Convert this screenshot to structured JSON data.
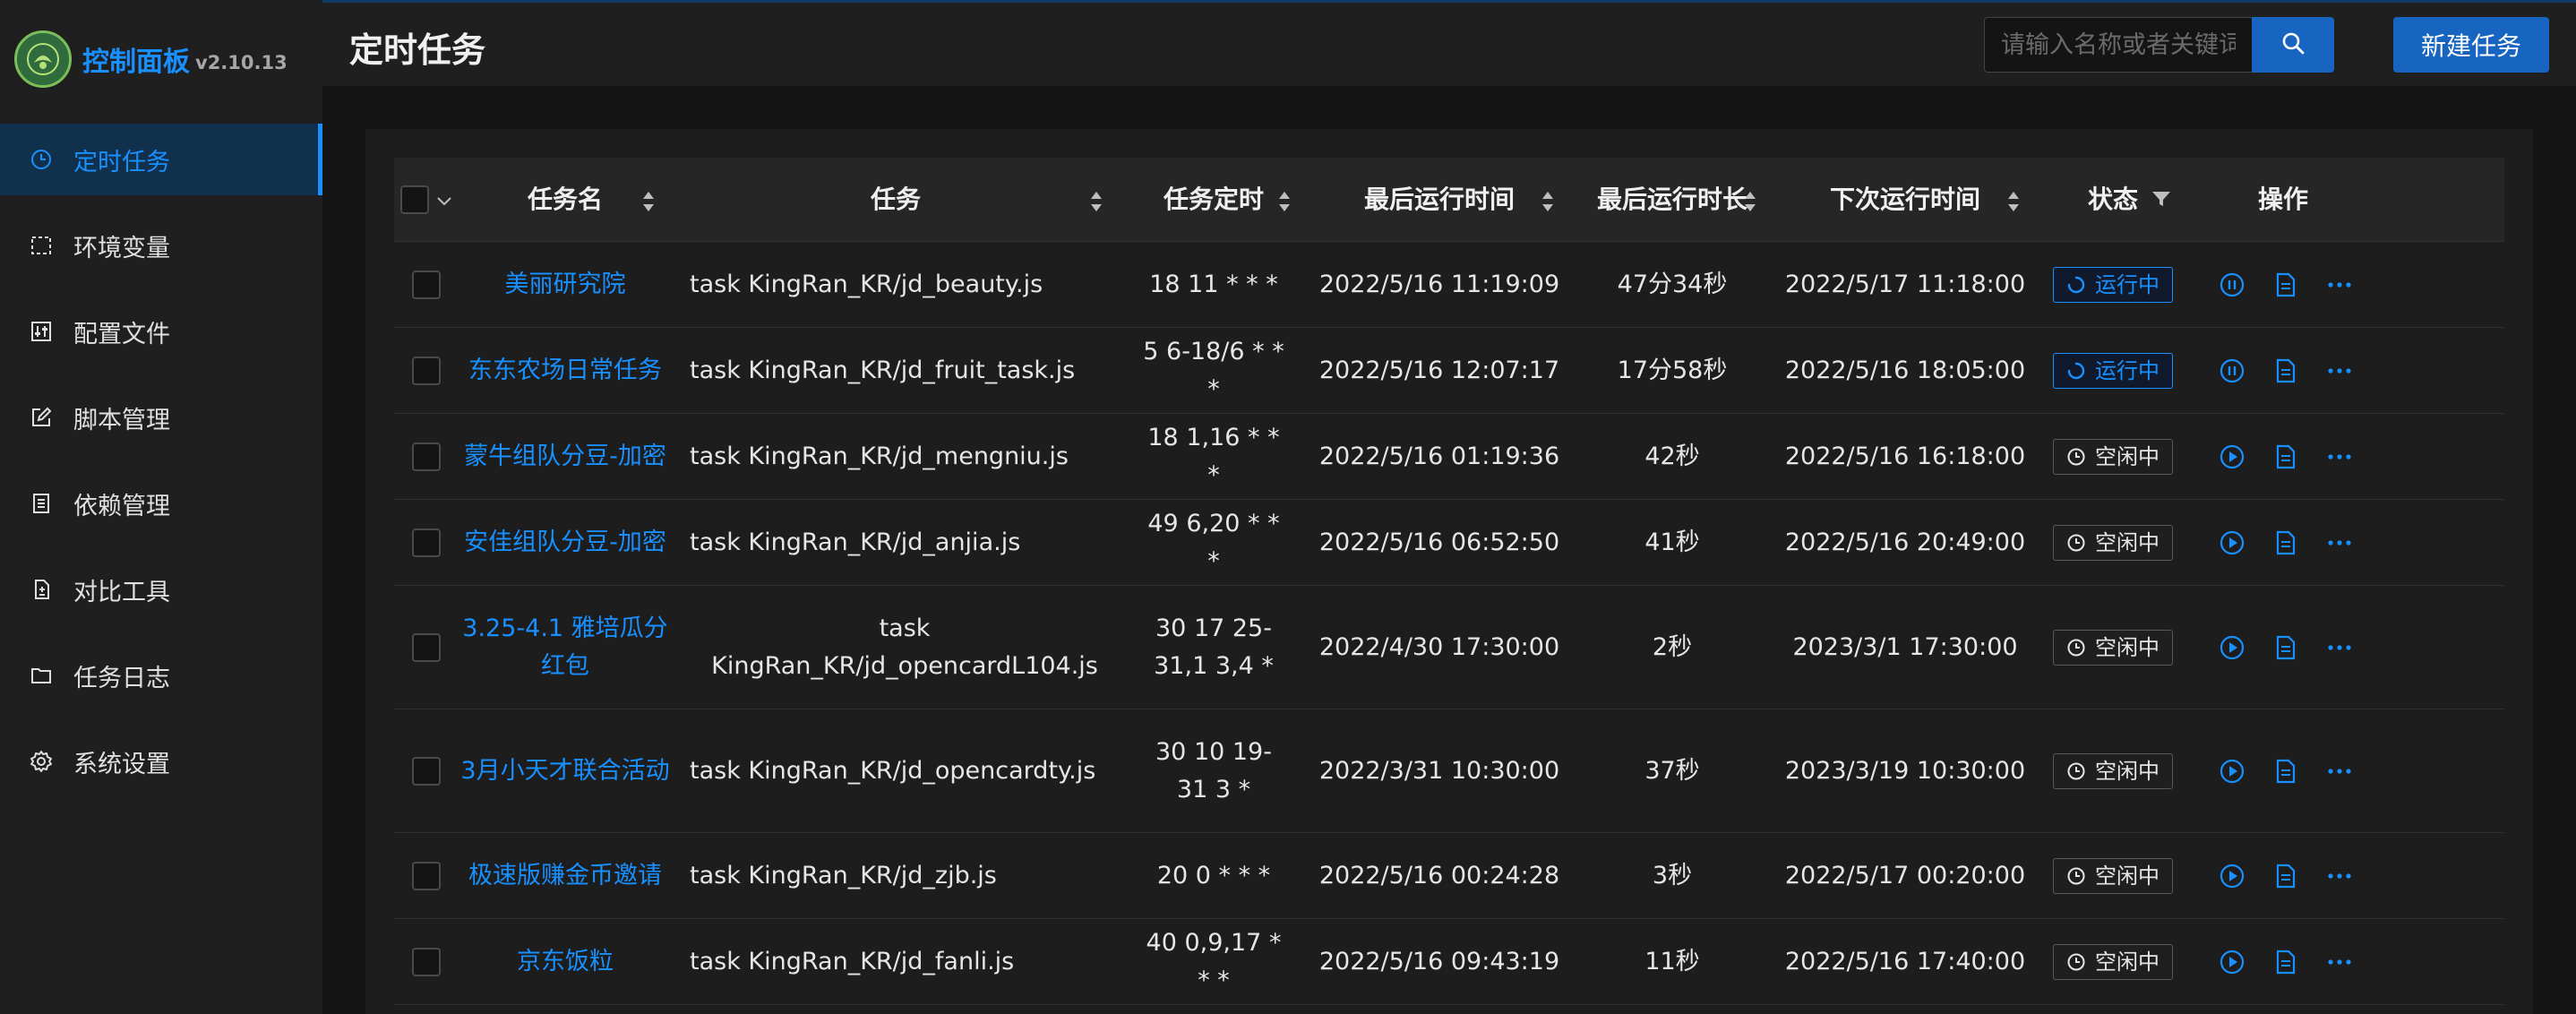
{
  "app": {
    "title": "控制面板",
    "version": "v2.10.13"
  },
  "sidebar": {
    "items": [
      {
        "label": "定时任务",
        "icon": "clock-icon",
        "active": true
      },
      {
        "label": "环境变量",
        "icon": "variable-icon",
        "active": false
      },
      {
        "label": "配置文件",
        "icon": "sliders-icon",
        "active": false
      },
      {
        "label": "脚本管理",
        "icon": "edit-icon",
        "active": false
      },
      {
        "label": "依赖管理",
        "icon": "package-icon",
        "active": false
      },
      {
        "label": "对比工具",
        "icon": "diff-icon",
        "active": false
      },
      {
        "label": "任务日志",
        "icon": "folder-icon",
        "active": false
      },
      {
        "label": "系统设置",
        "icon": "gear-icon",
        "active": false
      }
    ]
  },
  "header": {
    "title": "定时任务",
    "search_placeholder": "请输入名称或者关键词",
    "search_value": "",
    "new_task_label": "新建任务"
  },
  "table": {
    "columns": {
      "name": "任务名",
      "command": "任务",
      "schedule": "任务定时",
      "last_run": "最后运行时间",
      "last_duration": "最后运行时长",
      "next_run": "下次运行时间",
      "status": "状态",
      "actions": "操作"
    },
    "rows": [
      {
        "name": "美丽研究院",
        "command": "task KingRan_KR/jd_beauty.js",
        "schedule": "18 11 * * *",
        "last_run": "2022/5/16 11:19:09",
        "last_duration": "47分34秒",
        "next_run": "2022/5/17 11:18:00",
        "status": "运行中",
        "running": true
      },
      {
        "name": "东东农场日常任务",
        "command": "task KingRan_KR/jd_fruit_task.js",
        "schedule": "5 6-18/6 * * *",
        "last_run": "2022/5/16 12:07:17",
        "last_duration": "17分58秒",
        "next_run": "2022/5/16 18:05:00",
        "status": "运行中",
        "running": true
      },
      {
        "name": "蒙牛组队分豆-加密",
        "command": "task KingRan_KR/jd_mengniu.js",
        "schedule": "18 1,16 * * *",
        "last_run": "2022/5/16 01:19:36",
        "last_duration": "42秒",
        "next_run": "2022/5/16 16:18:00",
        "status": "空闲中",
        "running": false
      },
      {
        "name": "安佳组队分豆-加密",
        "command": "task KingRan_KR/jd_anjia.js",
        "schedule": "49 6,20 * * *",
        "last_run": "2022/5/16 06:52:50",
        "last_duration": "41秒",
        "next_run": "2022/5/16 20:49:00",
        "status": "空闲中",
        "running": false
      },
      {
        "name": "3.25-4.1 雅培瓜分红包",
        "command": "task KingRan_KR/jd_opencardL104.js",
        "schedule": "30 17 25-31,1 3,4 *",
        "last_run": "2022/4/30 17:30:00",
        "last_duration": "2秒",
        "next_run": "2023/3/1 17:30:00",
        "status": "空闲中",
        "running": false
      },
      {
        "name": "3月小天才联合活动",
        "command": "task KingRan_KR/jd_opencardty.js",
        "schedule": "30 10 19-31 3 *",
        "last_run": "2022/3/31 10:30:00",
        "last_duration": "37秒",
        "next_run": "2023/3/19 10:30:00",
        "status": "空闲中",
        "running": false
      },
      {
        "name": "极速版赚金币邀请",
        "command": "task KingRan_KR/jd_zjb.js",
        "schedule": "20 0 * * *",
        "last_run": "2022/5/16 00:24:28",
        "last_duration": "3秒",
        "next_run": "2022/5/17 00:20:00",
        "status": "空闲中",
        "running": false
      },
      {
        "name": "京东饭粒",
        "command": "task KingRan_KR/jd_fanli.js",
        "schedule": "40 0,9,17 * * *",
        "last_run": "2022/5/16 09:43:19",
        "last_duration": "11秒",
        "next_run": "2022/5/16 17:40:00",
        "status": "空闲中",
        "running": false
      }
    ]
  },
  "colors": {
    "accent": "#1890ff",
    "background": "#141414",
    "sidebar": "#1f1f1f"
  }
}
